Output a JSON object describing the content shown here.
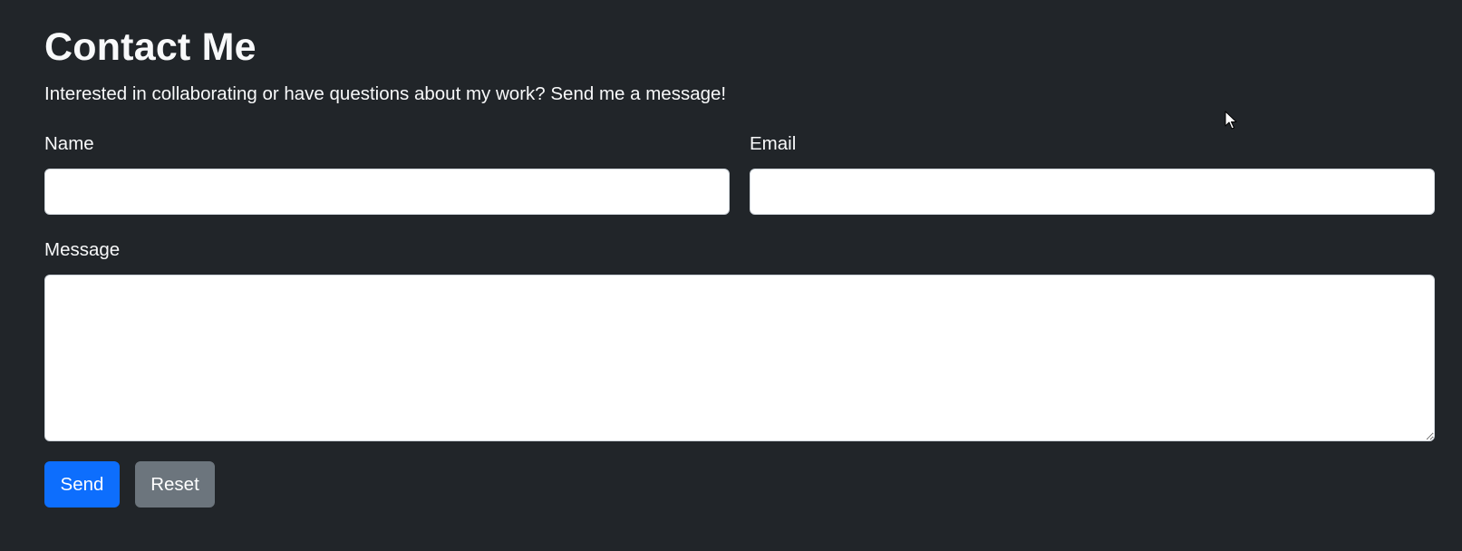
{
  "contact": {
    "title": "Contact Me",
    "lead": "Interested in collaborating or have questions about my work? Send me a message!",
    "name_label": "Name",
    "name_value": "",
    "email_label": "Email",
    "email_value": "",
    "message_label": "Message",
    "message_value": "",
    "send_label": "Send",
    "reset_label": "Reset"
  },
  "colors": {
    "background": "#212529",
    "primary": "#0d6efd",
    "secondary": "#6c757d"
  },
  "icons": {
    "cursor": "mouse-pointer-icon"
  }
}
